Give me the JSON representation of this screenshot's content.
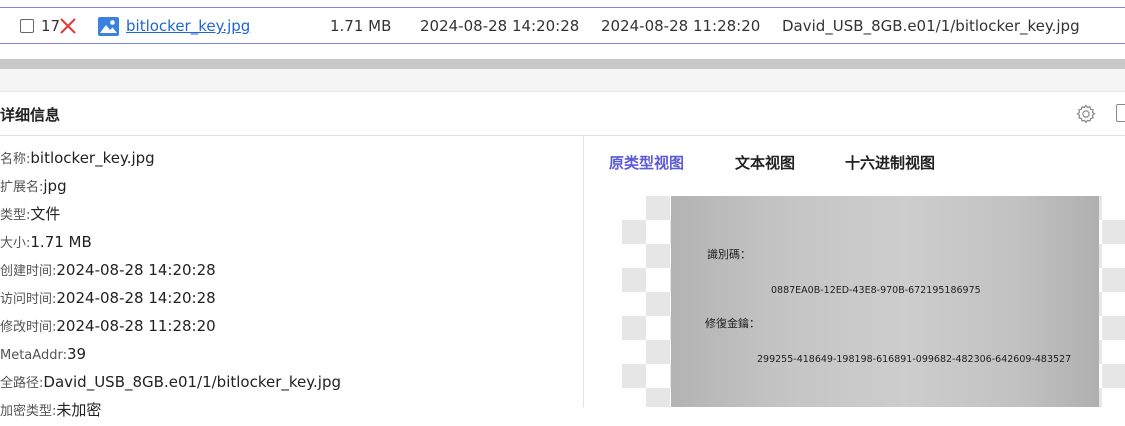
{
  "file_row": {
    "index": "17",
    "name": "bitlocker_key.jpg",
    "size": "1.71 MB",
    "created": "2024-08-28 14:20:28",
    "modified": "2024-08-28 11:28:20",
    "path": "David_USB_8GB.e01/1/bitlocker_key.jpg"
  },
  "details": {
    "title": "详细信息",
    "properties": [
      {
        "label": "名称:",
        "value": "bitlocker_key.jpg"
      },
      {
        "label": "扩展名:",
        "value": "jpg"
      },
      {
        "label": "类型:",
        "value": "文件"
      },
      {
        "label": "大小:",
        "value": "1.71 MB"
      },
      {
        "label": "创建时间:",
        "value": "2024-08-28 14:20:28"
      },
      {
        "label": "访问时间:",
        "value": "2024-08-28 14:20:28"
      },
      {
        "label": "修改时间:",
        "value": "2024-08-28 11:28:20"
      },
      {
        "label": "MetaAddr:",
        "value": "39"
      },
      {
        "label": "全路径:",
        "value": "David_USB_8GB.e01/1/bitlocker_key.jpg"
      },
      {
        "label": "加密类型:",
        "value": "未加密"
      }
    ]
  },
  "preview": {
    "tabs": [
      "原类型视图",
      "文本视图",
      "十六进制视图"
    ],
    "active_tab": "原类型视图",
    "image_text": {
      "id_label": "識別碼：",
      "id_value": "0887EA0B-12ED-43E8-970B-672195186975",
      "key_label": "修復金鑰：",
      "key_value": "299255-418649-198198-616891-099682-482306-642609-483527"
    }
  },
  "colors": {
    "accent": "#5b5bd6",
    "link": "#2066d6",
    "delete": "#e53935",
    "row_border": "#7c83e6"
  }
}
